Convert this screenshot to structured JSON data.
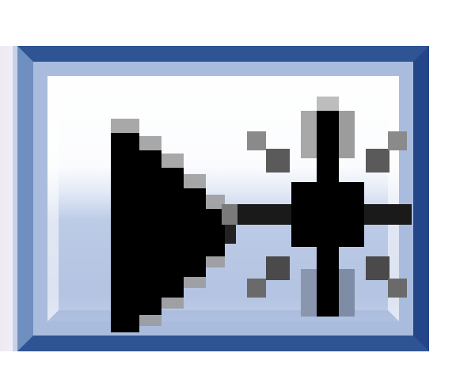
{
  "toolbar": {
    "run_button": {
      "icon": "run-to-cursor-icon",
      "colors": {
        "border": "#2e5494",
        "face_top": "#ffffff",
        "face_bottom": "#b3c3e1",
        "glyph": "#000000"
      }
    }
  }
}
